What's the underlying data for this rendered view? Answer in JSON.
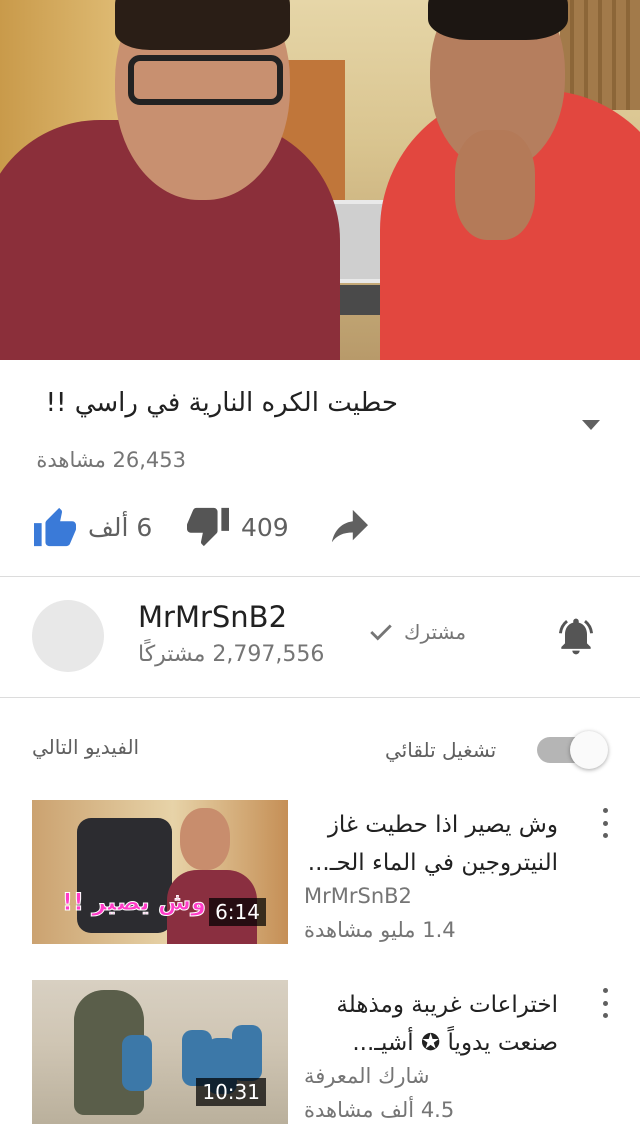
{
  "video": {
    "title": "حطيت الكره النارية في راسي !!",
    "views": "26,453 مشاهدة"
  },
  "actions": {
    "like_count": "6 ألف",
    "dislike_count": "409"
  },
  "channel": {
    "name": "MrMrSnB2",
    "subscribers": "2,797,556 مشتركًا",
    "subscribed_label": "مشترك"
  },
  "up_next": {
    "label": "الفيديو التالي",
    "autoplay_label": "تشغيل تلقائي",
    "autoplay_on": true
  },
  "items": [
    {
      "title": "وش يصير اذا حطيت غاز النيتروجين في الماء الحـ...",
      "channel": "MrMrSnB2",
      "views": "1.4 مليو مشاهدة",
      "duration": "6:14",
      "thumb_text": "وش يصير !!"
    },
    {
      "title": "اختراعات غريبة ومذهلة صنعت يدوياً ✪ أشيـ...",
      "channel": "شارك المعرفة",
      "views": "4.5 ألف مشاهدة",
      "duration": "10:31"
    }
  ],
  "colors": {
    "like_blue": "#3a7ad8",
    "icon_gray": "#606060",
    "toggle_gray": "#b5b5b5"
  },
  "icons": [
    "thumbs-up-icon",
    "thumbs-down-icon",
    "share-icon",
    "check-icon",
    "bell-icon",
    "chevron-down-icon",
    "more-vert-icon"
  ]
}
